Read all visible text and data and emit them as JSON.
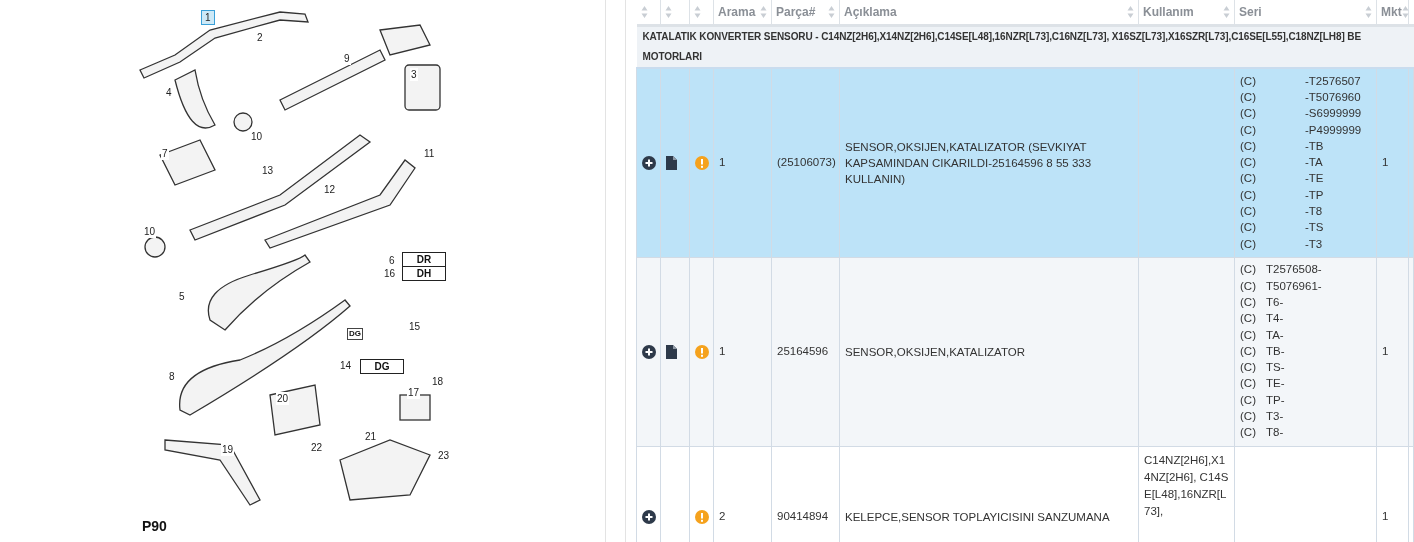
{
  "diagram": {
    "code": "P90",
    "callouts": [
      {
        "label": "1",
        "selected": true
      },
      {
        "label": "2",
        "selected": false
      },
      {
        "label": "3",
        "selected": false
      },
      {
        "label": "4",
        "selected": false
      },
      {
        "label": "9",
        "selected": false
      },
      {
        "label": "10",
        "selected": false
      },
      {
        "label": "7",
        "selected": false
      },
      {
        "label": "11",
        "selected": false
      },
      {
        "label": "13",
        "selected": false
      },
      {
        "label": "12",
        "selected": false
      },
      {
        "label": "10",
        "selected": false
      },
      {
        "label": "6",
        "selected": false
      },
      {
        "label": "16",
        "selected": false
      },
      {
        "label": "5",
        "selected": false
      },
      {
        "label": "15",
        "selected": false
      },
      {
        "label": "8",
        "selected": false
      },
      {
        "label": "14",
        "selected": false
      },
      {
        "label": "18",
        "selected": false
      },
      {
        "label": "17",
        "selected": false
      },
      {
        "label": "20",
        "selected": false
      },
      {
        "label": "22",
        "selected": false
      },
      {
        "label": "19",
        "selected": false
      },
      {
        "label": "21",
        "selected": false
      },
      {
        "label": "23",
        "selected": false
      }
    ],
    "tags": [
      "DR",
      "DH",
      "DG",
      "DG"
    ]
  },
  "table": {
    "columns": [
      "",
      "",
      "",
      "Arama",
      "Parça#",
      "Açıklama",
      "Kullanım",
      "Seri",
      "Mkt"
    ],
    "group": "KATALATIK KONVERTER SENSORU - C14NZ[2H6],X14NZ[2H6],C14SE[L48],16NZR[L73],C16NZ[L73], X16SZ[L73],X16SZR[L73],C16SE[L55],C18NZ[LH8] BE\nMOTORLARI",
    "rows": [
      {
        "selected": true,
        "has_document": true,
        "arama": "1",
        "parca": "(25106073)",
        "aciklama": "SENSOR,OKSIJEN,KATALIZATOR (SEVKIYAT KAPSAMINDAN CIKARILDI-25164596 8 55 333 KULLANIN)",
        "kullanim": "",
        "seri": [
          {
            "kind": "columns",
            "prefix": "(C)",
            "value": "-T2576507"
          },
          {
            "kind": "columns",
            "prefix": "(C)",
            "value": "-T5076960"
          },
          {
            "kind": "columns",
            "prefix": "(C)",
            "value": "-S6999999"
          },
          {
            "kind": "columns",
            "prefix": "(C)",
            "value": "-P4999999"
          },
          {
            "kind": "columns",
            "prefix": "(C)",
            "value": "-TB"
          },
          {
            "kind": "columns",
            "prefix": "(C)",
            "value": "-TA"
          },
          {
            "kind": "columns",
            "prefix": "(C)",
            "value": "-TE"
          },
          {
            "kind": "columns",
            "prefix": "(C)",
            "value": "-TP"
          },
          {
            "kind": "columns",
            "prefix": "(C)",
            "value": "-T8"
          },
          {
            "kind": "columns",
            "prefix": "(C)",
            "value": "-TS"
          },
          {
            "kind": "columns",
            "prefix": "(C)",
            "value": "-T3"
          }
        ],
        "mkt": "1"
      },
      {
        "selected": false,
        "has_document": true,
        "arama": "1",
        "parca": "25164596",
        "aciklama": "SENSOR,OKSIJEN,KATALIZATOR",
        "kullanim": "",
        "seri": [
          {
            "kind": "inline",
            "prefix": "(C)",
            "value": "T2576508-"
          },
          {
            "kind": "inline",
            "prefix": "(C)",
            "value": "T5076961-"
          },
          {
            "kind": "inline",
            "prefix": "(C)",
            "value": "T6-"
          },
          {
            "kind": "inline",
            "prefix": "(C)",
            "value": "T4-"
          },
          {
            "kind": "inline",
            "prefix": "(C)",
            "value": "TA-"
          },
          {
            "kind": "inline",
            "prefix": "(C)",
            "value": "TB-"
          },
          {
            "kind": "inline",
            "prefix": "(C)",
            "value": "TS-"
          },
          {
            "kind": "inline",
            "prefix": "(C)",
            "value": "TE-"
          },
          {
            "kind": "inline",
            "prefix": "(C)",
            "value": "TP-"
          },
          {
            "kind": "inline",
            "prefix": "(C)",
            "value": "T3-"
          },
          {
            "kind": "inline",
            "prefix": "(C)",
            "value": "T8-"
          }
        ],
        "mkt": "1"
      },
      {
        "selected": false,
        "has_document": false,
        "arama": "2",
        "parca": "90414894",
        "aciklama": "KELEPCE,SENSOR TOPLAYICISINI SANZUMANA",
        "kullanim": "C14NZ[2H6],X14NZ[2H6], C14SE[L48],16NZR[L73],",
        "seri": [],
        "mkt": "1"
      }
    ]
  }
}
